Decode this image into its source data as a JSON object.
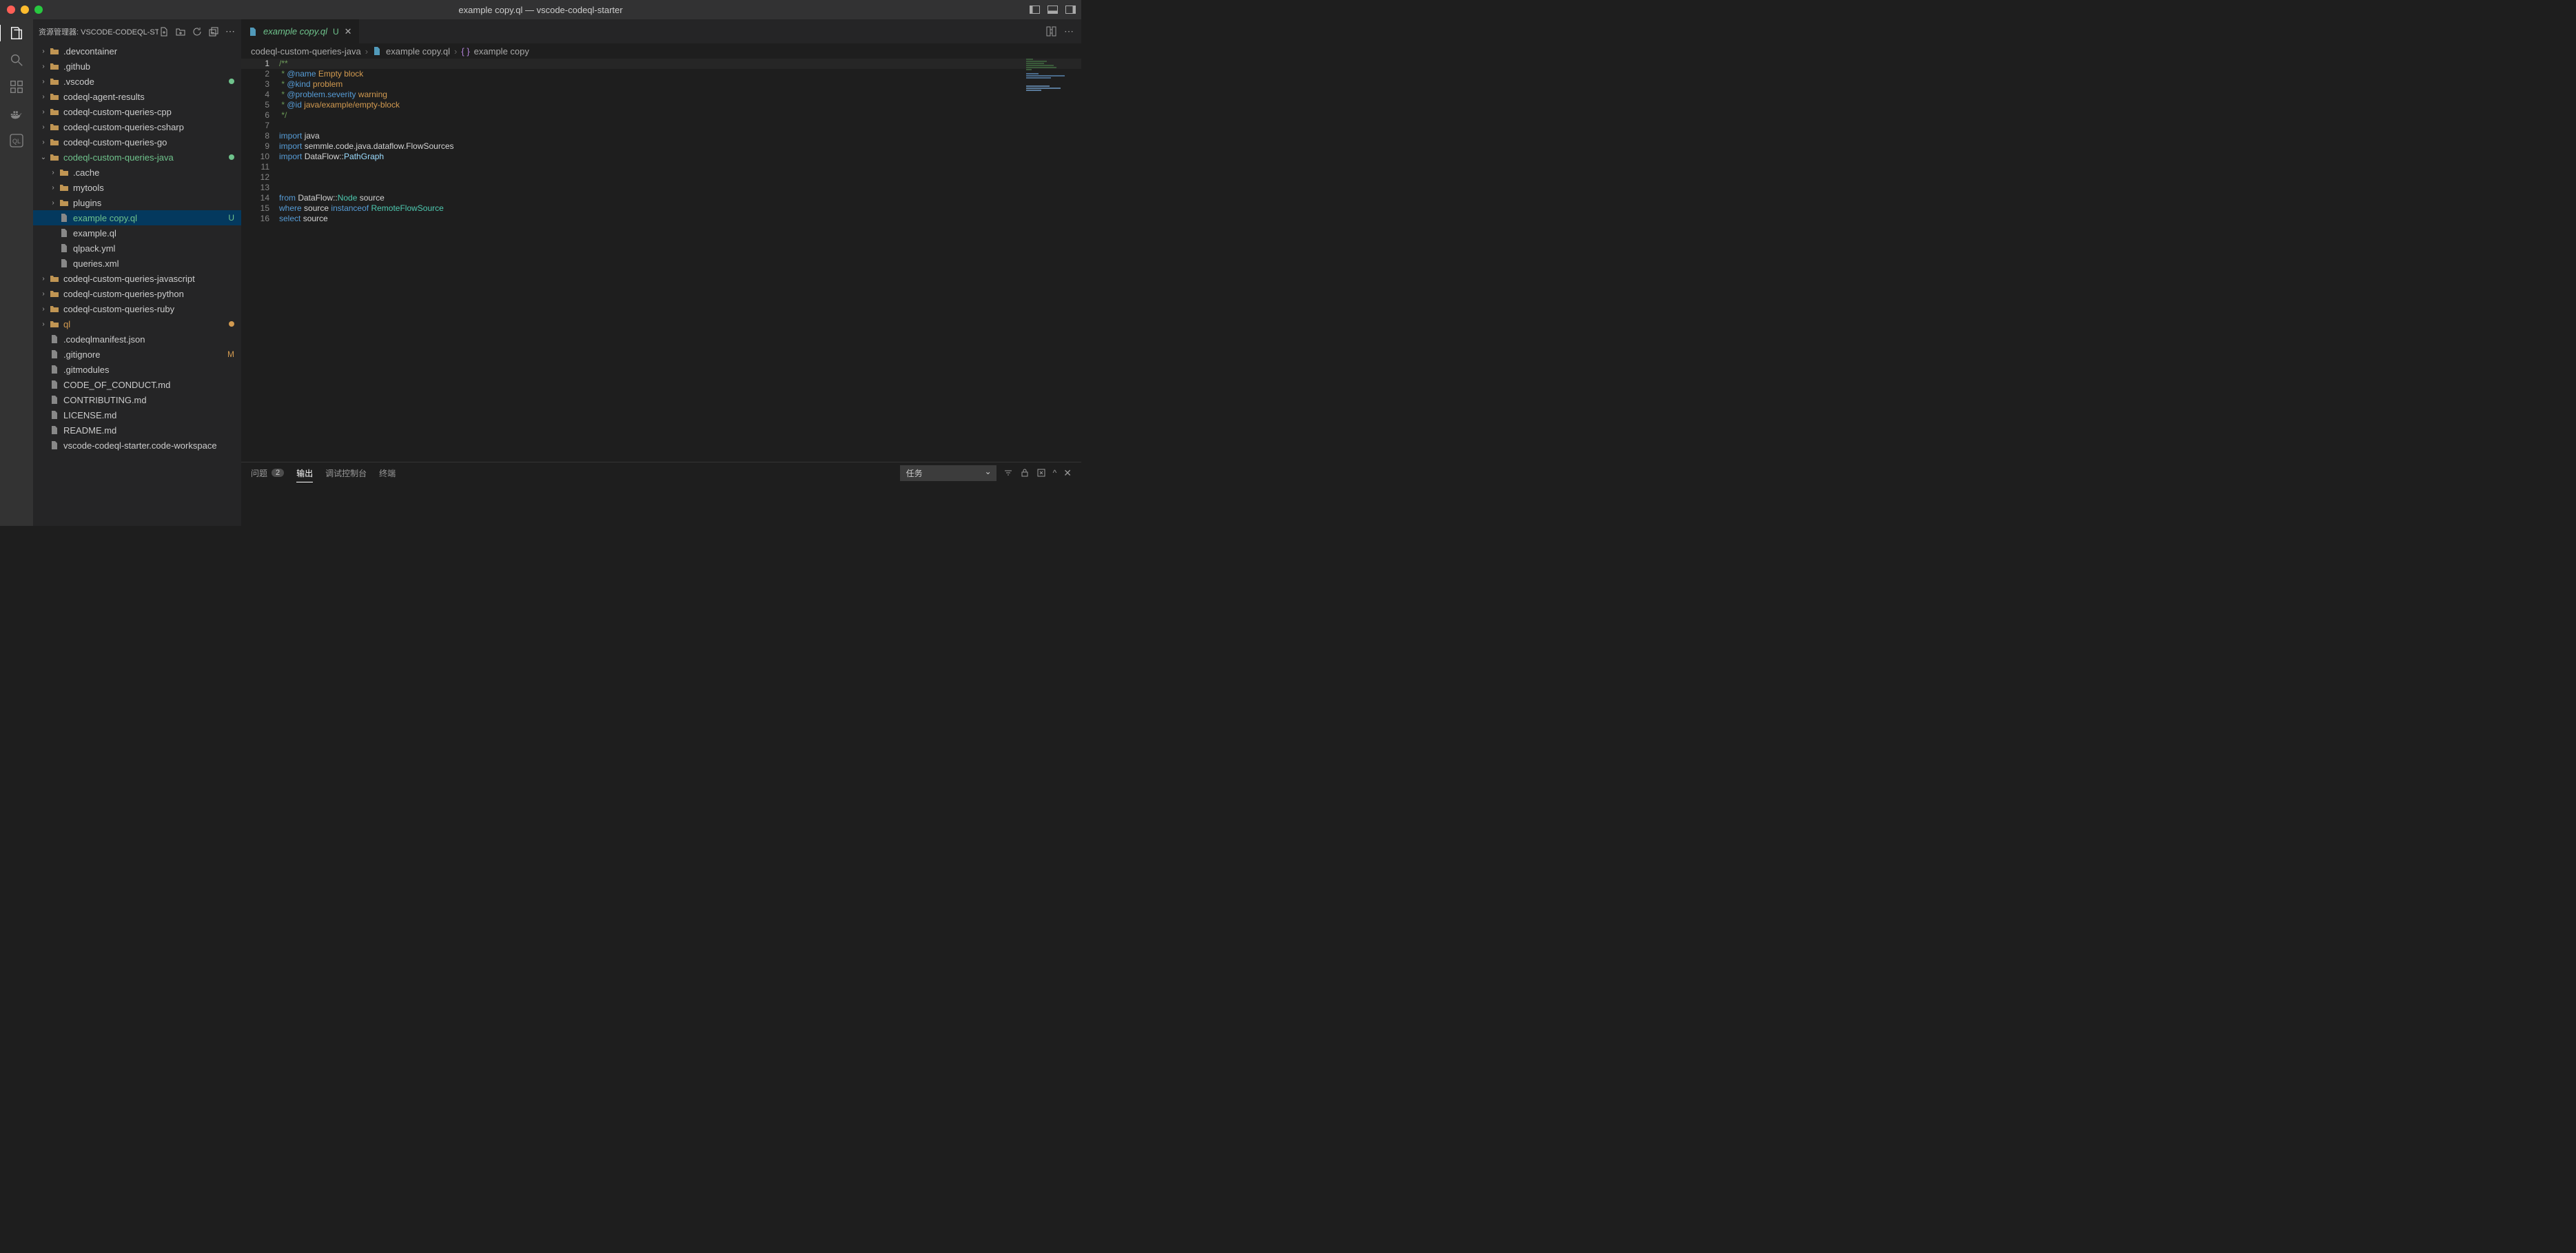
{
  "window": {
    "title": "example copy.ql — vscode-codeql-starter"
  },
  "explorer": {
    "header": "资源管理器: VSCODE-CODEQL-STARTER"
  },
  "tree": [
    {
      "kind": "folder",
      "name": ".devcontainer",
      "indent": 0,
      "chev": "›"
    },
    {
      "kind": "folder",
      "name": ".github",
      "indent": 0,
      "chev": "›"
    },
    {
      "kind": "folder",
      "name": ".vscode",
      "indent": 0,
      "chev": "›",
      "dot": true
    },
    {
      "kind": "folder",
      "name": "codeql-agent-results",
      "indent": 0,
      "chev": "›"
    },
    {
      "kind": "folder",
      "name": "codeql-custom-queries-cpp",
      "indent": 0,
      "chev": "›"
    },
    {
      "kind": "folder",
      "name": "codeql-custom-queries-csharp",
      "indent": 0,
      "chev": "›"
    },
    {
      "kind": "folder",
      "name": "codeql-custom-queries-go",
      "indent": 0,
      "chev": "›"
    },
    {
      "kind": "folder",
      "name": "codeql-custom-queries-java",
      "indent": 0,
      "chev": "⌄",
      "green": true,
      "dot": true
    },
    {
      "kind": "folder",
      "name": ".cache",
      "indent": 1,
      "chev": "›"
    },
    {
      "kind": "folder",
      "name": "mytools",
      "indent": 1,
      "chev": "›"
    },
    {
      "kind": "folder",
      "name": "plugins",
      "indent": 1,
      "chev": "›"
    },
    {
      "kind": "file",
      "name": "example copy.ql",
      "indent": 1,
      "selected": true,
      "badge": "U",
      "green": true,
      "icon": "ql"
    },
    {
      "kind": "file",
      "name": "example.ql",
      "indent": 1,
      "icon": "ql"
    },
    {
      "kind": "file",
      "name": "qlpack.yml",
      "indent": 1,
      "icon": "yml"
    },
    {
      "kind": "file",
      "name": "queries.xml",
      "indent": 1,
      "icon": "xml"
    },
    {
      "kind": "folder",
      "name": "codeql-custom-queries-javascript",
      "indent": 0,
      "chev": "›"
    },
    {
      "kind": "folder",
      "name": "codeql-custom-queries-python",
      "indent": 0,
      "chev": "›"
    },
    {
      "kind": "folder",
      "name": "codeql-custom-queries-ruby",
      "indent": 0,
      "chev": "›"
    },
    {
      "kind": "folder",
      "name": "ql",
      "indent": 0,
      "chev": "›",
      "redish": true,
      "dot": true,
      "dotcolor": "#d29a50"
    },
    {
      "kind": "file",
      "name": ".codeqlmanifest.json",
      "indent": 0,
      "icon": "json"
    },
    {
      "kind": "file",
      "name": ".gitignore",
      "indent": 0,
      "badge": "M",
      "orange": true,
      "icon": "txt"
    },
    {
      "kind": "file",
      "name": ".gitmodules",
      "indent": 0,
      "icon": "txt"
    },
    {
      "kind": "file",
      "name": "CODE_OF_CONDUCT.md",
      "indent": 0,
      "icon": "md"
    },
    {
      "kind": "file",
      "name": "CONTRIBUTING.md",
      "indent": 0,
      "icon": "md"
    },
    {
      "kind": "file",
      "name": "LICENSE.md",
      "indent": 0,
      "icon": "md"
    },
    {
      "kind": "file",
      "name": "README.md",
      "indent": 0,
      "icon": "md"
    },
    {
      "kind": "file",
      "name": "vscode-codeql-starter.code-workspace",
      "indent": 0,
      "icon": "ws"
    }
  ],
  "tab": {
    "filename": "example copy.ql",
    "status": "U"
  },
  "breadcrumb": {
    "p1": "codeql-custom-queries-java",
    "p2": "example copy.ql",
    "p3": "example copy"
  },
  "code": {
    "lines": [
      {
        "n": 1,
        "html": "<span class='c-comment'>/**</span>"
      },
      {
        "n": 2,
        "html": "<span class='c-comment'> * </span><span class='c-tag'>@name</span><span class='c-comment'> </span><span class='c-name'>Empty block</span>"
      },
      {
        "n": 3,
        "html": "<span class='c-comment'> * </span><span class='c-tag'>@kind</span><span class='c-comment'> </span><span class='c-name'>problem</span>"
      },
      {
        "n": 4,
        "html": "<span class='c-comment'> * </span><span class='c-tag'>@problem.severity</span><span class='c-comment'> </span><span class='c-name'>warning</span>"
      },
      {
        "n": 5,
        "html": "<span class='c-comment'> * </span><span class='c-tag'>@id</span><span class='c-comment'> </span><span class='c-name'>java/example/empty-block</span>"
      },
      {
        "n": 6,
        "html": "<span class='c-comment'> */</span>"
      },
      {
        "n": 7,
        "html": ""
      },
      {
        "n": 8,
        "html": "<span class='c-import'>import</span> <span class='c-mod'>java</span>"
      },
      {
        "n": 9,
        "html": "<span class='c-import'>import</span> <span class='c-mod'>semmle</span><span class='c-dot'>.</span><span class='c-mod'>code</span><span class='c-dot'>.</span><span class='c-mod'>java</span><span class='c-dot'>.</span><span class='c-mod'>dataflow</span><span class='c-dot'>.</span><span class='c-mod'>FlowSources</span>"
      },
      {
        "n": 10,
        "html": "<span class='c-import'>import</span> <span class='c-mod'>DataFlow</span><span class='c-dot'>::</span><span class='c-id'>PathGraph</span>"
      },
      {
        "n": 11,
        "html": ""
      },
      {
        "n": 12,
        "html": ""
      },
      {
        "n": 13,
        "html": ""
      },
      {
        "n": 14,
        "html": "<span class='c-kw'>from</span> <span class='c-w'>DataFlow</span><span class='c-dot'>::</span><span class='c-type'>Node</span> <span class='c-w'>source</span>"
      },
      {
        "n": 15,
        "html": "<span class='c-kw'>where</span> <span class='c-w'>source</span> <span class='c-kw'>instanceof</span> <span class='c-type'>RemoteFlowSource</span>"
      },
      {
        "n": 16,
        "html": "<span class='c-kw'>select</span> <span class='c-w'>source</span>"
      }
    ]
  },
  "panel": {
    "tabs": {
      "problems": "问题",
      "problemsCount": "2",
      "output": "输出",
      "debugConsole": "调试控制台",
      "terminal": "终端"
    },
    "dropdown": "任务"
  }
}
